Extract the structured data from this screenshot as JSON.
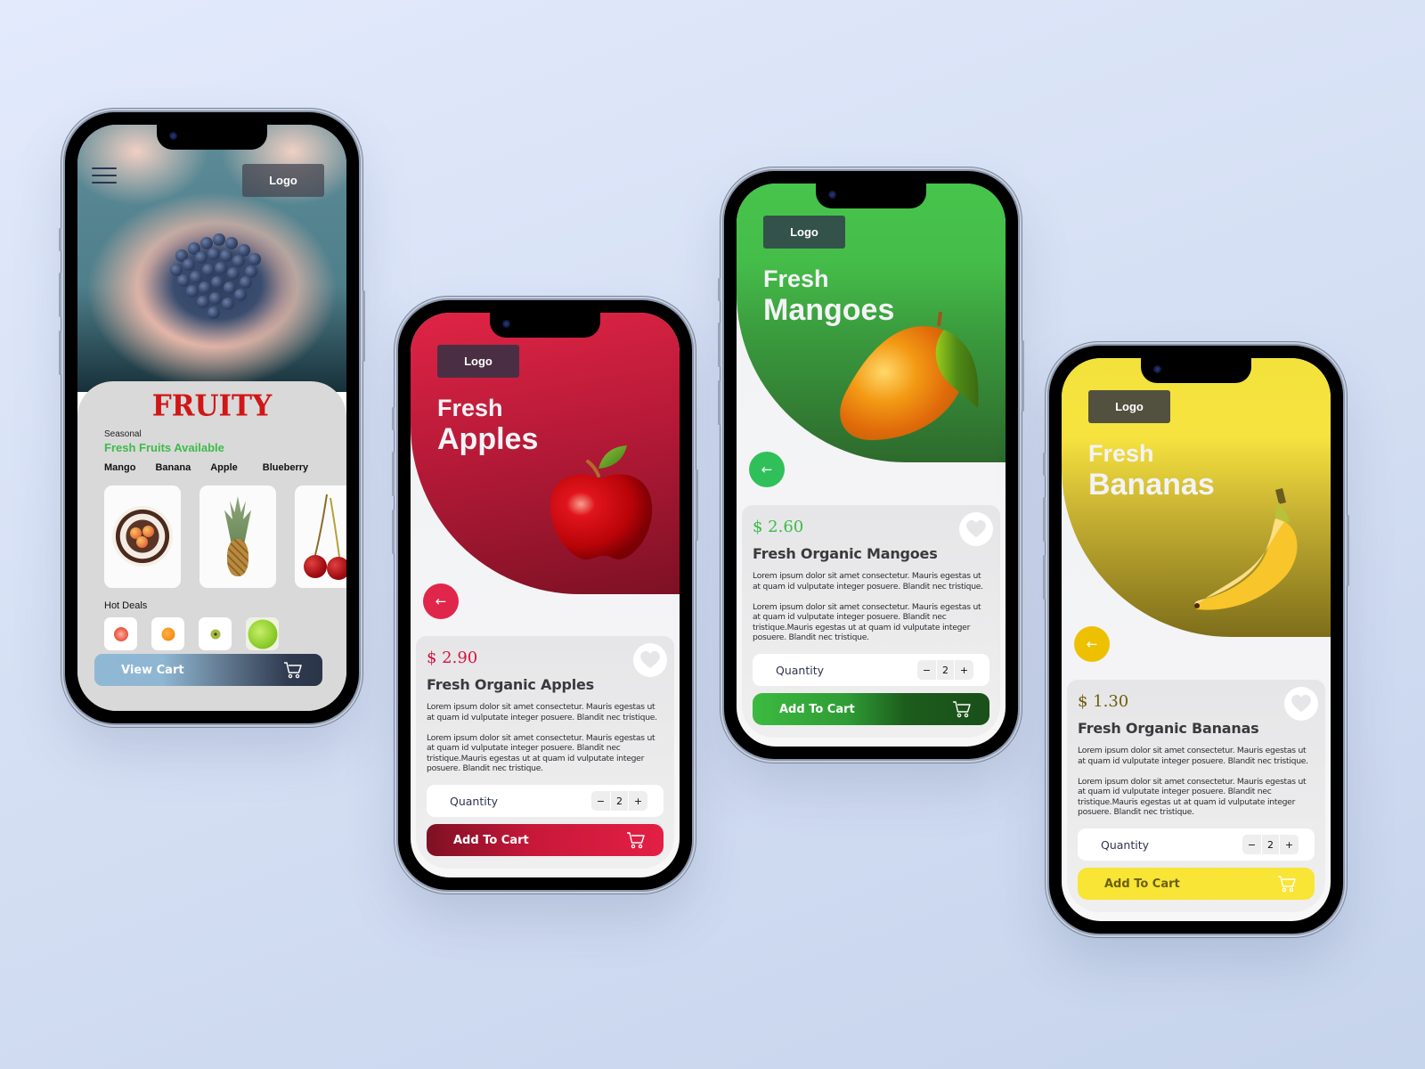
{
  "home": {
    "logo_label": "Logo",
    "brand": "FRUITY",
    "season_small": "Seasonal",
    "season_big": "Fresh Fruits Available",
    "categories": [
      "Mango",
      "Banana",
      "Apple",
      "Blueberry"
    ],
    "fruit_cards": [
      "apples-bowl",
      "pineapple",
      "cherries"
    ],
    "hot_deals_title": "Hot Deals",
    "hot_deals": [
      "grapefruit",
      "orange",
      "kiwi",
      "green-apple"
    ],
    "view_cart_label": "View Cart"
  },
  "products": [
    {
      "id": "apples",
      "logo_label": "Logo",
      "hero_line1": "Fresh",
      "hero_line2": "Apples",
      "price": "$ 2.90",
      "name": "Fresh Organic Apples",
      "desc1": "Lorem ipsum dolor sit amet consectetur. Mauris egestas ut at quam id vulputate integer posuere. Blandit nec tristique.",
      "desc2": "Lorem ipsum dolor sit amet consectetur. Mauris egestas ut at quam id vulputate integer posuere. Blandit nec tristique.Mauris egestas ut at quam id vulputate integer posuere. Blandit nec tristique.",
      "quantity_label": "Quantity",
      "quantity": "2",
      "minus": "−",
      "plus": "+",
      "add_to_cart": "Add To Cart",
      "accent": "#e0264b"
    },
    {
      "id": "mangoes",
      "logo_label": "Logo",
      "hero_line1": "Fresh",
      "hero_line2": "Mangoes",
      "price": "$ 2.60",
      "name": "Fresh Organic Mangoes",
      "desc1": "Lorem ipsum dolor sit amet consectetur. Mauris egestas ut at quam id vulputate integer posuere. Blandit nec tristique.",
      "desc2": "Lorem ipsum dolor sit amet consectetur. Mauris egestas ut at quam id vulputate integer posuere. Blandit nec tristique.Mauris egestas ut at quam id vulputate integer posuere. Blandit nec tristique.",
      "quantity_label": "Quantity",
      "quantity": "2",
      "minus": "−",
      "plus": "+",
      "add_to_cart": "Add To Cart",
      "accent": "#3dbb48"
    },
    {
      "id": "bananas",
      "logo_label": "Logo",
      "hero_line1": "Fresh",
      "hero_line2": "Bananas",
      "price": "$ 1.30",
      "name": "Fresh Organic Bananas",
      "desc1": "Lorem ipsum dolor sit amet consectetur. Mauris egestas ut at quam id vulputate integer posuere. Blandit nec tristique.",
      "desc2": "Lorem ipsum dolor sit amet consectetur. Mauris egestas ut at quam id vulputate integer posuere. Blandit nec tristique.Mauris egestas ut at quam id vulputate integer posuere. Blandit nec tristique.",
      "quantity_label": "Quantity",
      "quantity": "2",
      "minus": "−",
      "plus": "+",
      "add_to_cart": "Add To Cart",
      "accent": "#eec100"
    }
  ],
  "icons": {
    "back": "←",
    "menu": "hamburger-icon",
    "cart": "cart-icon",
    "favorite": "heart-icon"
  }
}
